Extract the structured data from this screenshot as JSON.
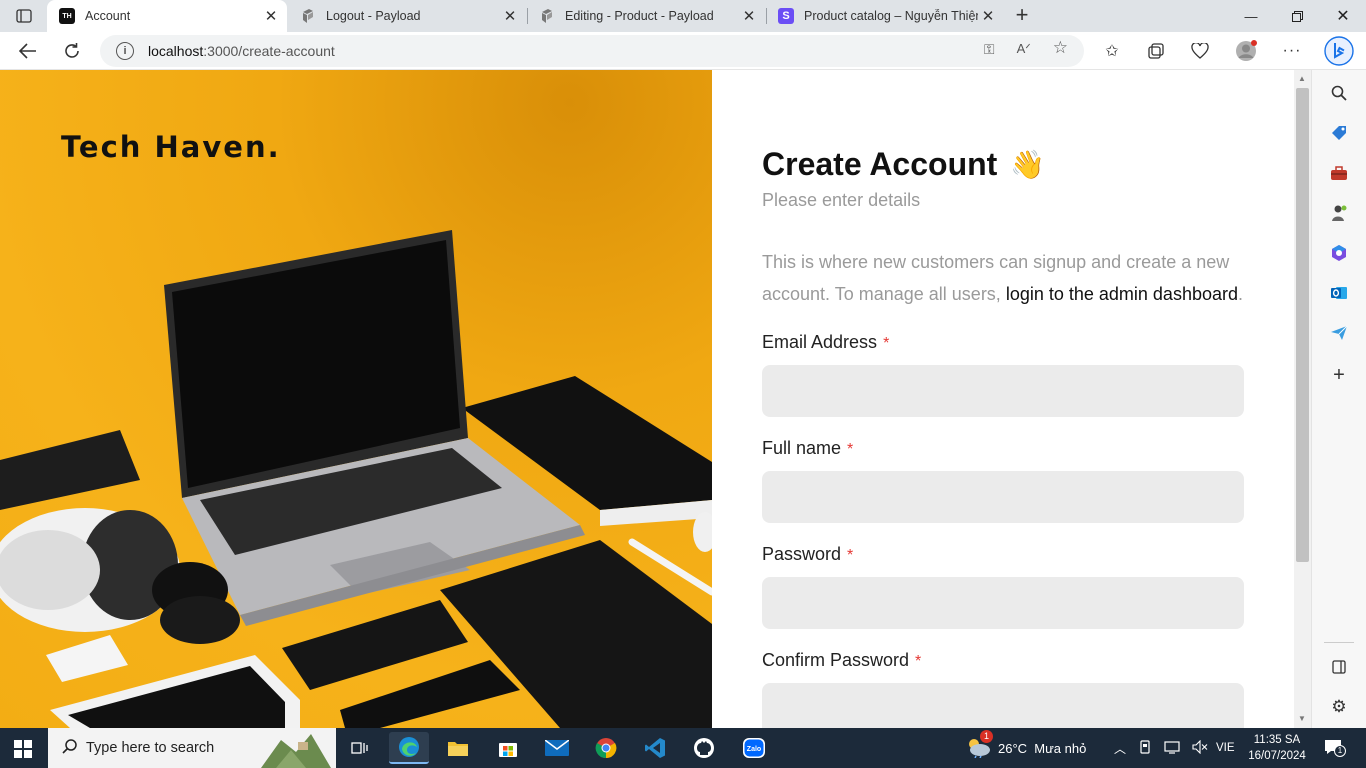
{
  "browser": {
    "tabs": [
      {
        "title": "Account",
        "favicon": "TH",
        "active": true
      },
      {
        "title": "Logout - Payload",
        "favicon": "payload-icon",
        "active": false
      },
      {
        "title": "Editing - Product - Payload",
        "favicon": "payload-icon",
        "active": false
      },
      {
        "title": "Product catalog – Nguyễn Thiện",
        "favicon": "S",
        "active": false
      }
    ],
    "url_host": "localhost",
    "url_path": ":3000/create-account"
  },
  "page": {
    "brand": "Tech Haven.",
    "title": "Create Account",
    "title_emoji": "👋",
    "subtitle": "Please enter details",
    "intro_text": "This is where new customers can signup and create a new account. To manage all users,",
    "intro_link": "login to the admin dashboard",
    "intro_end": ".",
    "fields": [
      {
        "label": "Email Address",
        "required_mark": "*",
        "value": ""
      },
      {
        "label": "Full name",
        "required_mark": "*",
        "value": ""
      },
      {
        "label": "Password",
        "required_mark": "*",
        "value": ""
      },
      {
        "label": "Confirm Password",
        "required_mark": "*",
        "value": ""
      }
    ]
  },
  "taskbar": {
    "search_placeholder": "Type here to search",
    "weather": "26°C  Mưa nhỏ",
    "weather_badge": "1",
    "language": "VIE",
    "time": "11:35 SA",
    "date": "16/07/2024",
    "notification_count": "1"
  },
  "colors": {
    "hero_background": "#f3ad14",
    "required": "#e53935",
    "input_background": "#ebebeb",
    "taskbar": "#1c2a3a"
  }
}
